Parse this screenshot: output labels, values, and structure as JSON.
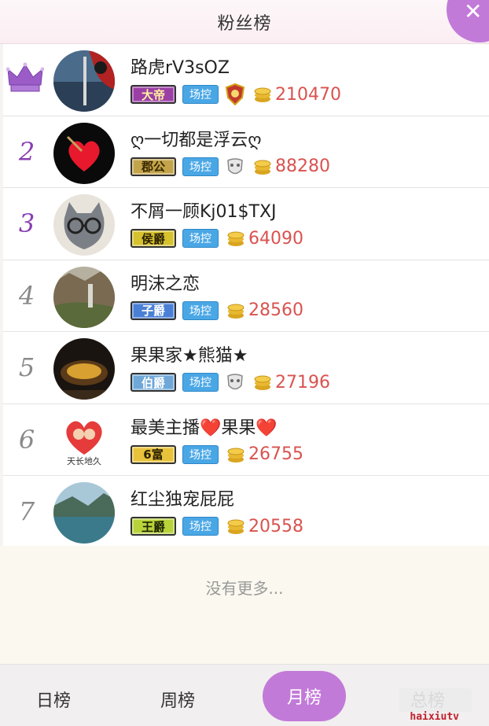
{
  "header": {
    "title": "粉丝榜",
    "close_icon": "close-icon"
  },
  "colors": {
    "accent": "#c27ad8",
    "amount": "#d9534f",
    "control_badge": "#4aa7e6"
  },
  "fans": [
    {
      "rank": "",
      "crown": true,
      "name": "路虎rV3sOZ",
      "title_badge": "大帝",
      "badge_color": "#9b3fa6",
      "control": "场控",
      "medal": "shield-medal-icon",
      "amount": "210470"
    },
    {
      "rank": "2",
      "name": "ღ一切都是浮云ღ",
      "title_badge": "郡公",
      "badge_color": "#c3a44a",
      "control": "场控",
      "medal": "mask-icon",
      "amount": "88280"
    },
    {
      "rank": "3",
      "name": "不屑一顾Kj01$TXJ",
      "title_badge": "侯爵",
      "badge_color": "#d6c12e",
      "control": "场控",
      "medal": "",
      "amount": "64090"
    },
    {
      "rank": "4",
      "name": "明沫之恋",
      "title_badge": "子爵",
      "badge_color": "#4a7fd6",
      "control": "场控",
      "medal": "",
      "amount": "28560"
    },
    {
      "rank": "5",
      "name": "果果家★熊猫★",
      "title_badge": "伯爵",
      "badge_color": "#6fa7d8",
      "control": "场控",
      "medal": "mask-icon",
      "amount": "27196"
    },
    {
      "rank": "6",
      "name": "最美主播❤️果果❤️",
      "title_badge": "6富",
      "badge_color": "#e8c23a",
      "control": "场控",
      "medal": "",
      "amount": "26755"
    },
    {
      "rank": "7",
      "name": "红尘独宠屁屁",
      "title_badge": "王爵",
      "badge_color": "#b8d23a",
      "control": "场控",
      "medal": "",
      "amount": "20558"
    }
  ],
  "avatar_caption_6": "天长地久",
  "footer": {
    "no_more": "没有更多..."
  },
  "tabs": {
    "daily": "日榜",
    "weekly": "周榜",
    "monthly": "月榜",
    "total": "总榜"
  },
  "watermark": "haixiutv"
}
